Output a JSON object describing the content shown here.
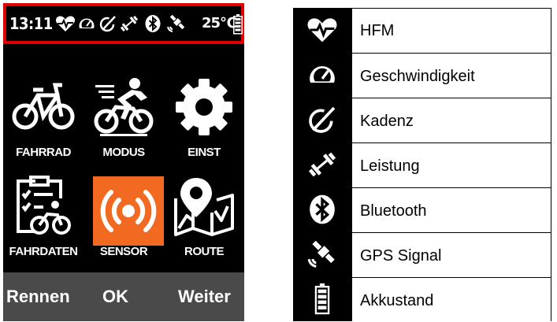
{
  "status_bar": {
    "time": "13:11",
    "temperature": "25℃",
    "icons": [
      "heart-rate-icon",
      "speed-icon",
      "cadence-icon",
      "power-icon",
      "bluetooth-icon",
      "gps-icon",
      "battery-icon"
    ],
    "highlight_color": "#e00000"
  },
  "menu": {
    "tiles": [
      {
        "label": "FAHRRAD",
        "icon": "bicycle-icon"
      },
      {
        "label": "MODUS",
        "icon": "cyclist-icon"
      },
      {
        "label": "EINST",
        "icon": "gear-icon"
      },
      {
        "label": "FAHRDATEN",
        "icon": "ride-data-icon"
      },
      {
        "label": "SENSOR",
        "icon": "sensor-icon",
        "selected": true
      },
      {
        "label": "ROUTE",
        "icon": "route-map-icon"
      }
    ],
    "selected_color": "#f26a21"
  },
  "softkeys": {
    "left": "Rennen",
    "center": "OK",
    "right": "Weiter"
  },
  "legend": {
    "items": [
      {
        "icon": "heart-rate-icon",
        "label": "HFM"
      },
      {
        "icon": "speed-icon",
        "label": "Geschwindigkeit"
      },
      {
        "icon": "cadence-icon",
        "label": "Kadenz"
      },
      {
        "icon": "power-icon",
        "label": "Leistung"
      },
      {
        "icon": "bluetooth-icon",
        "label": "Bluetooth"
      },
      {
        "icon": "gps-icon",
        "label": "GPS Signal"
      },
      {
        "icon": "battery-icon",
        "label": "Akkustand"
      }
    ]
  }
}
